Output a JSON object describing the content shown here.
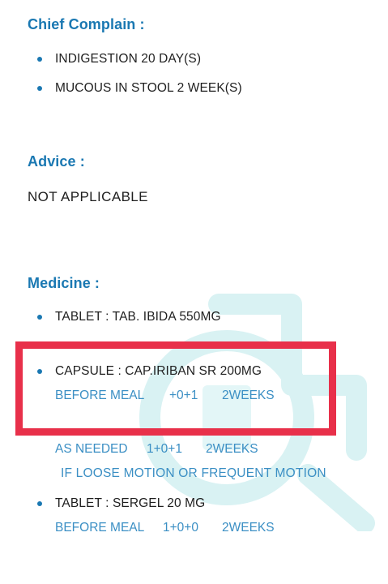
{
  "chief_complain": {
    "heading": "Chief Complain :",
    "items": [
      "INDIGESTION 20 DAY(S)",
      "MUCOUS IN STOOL 2 WEEK(S)"
    ]
  },
  "advice": {
    "heading": "Advice :",
    "text": "NOT APPLICABLE"
  },
  "medicine": {
    "heading": "Medicine :",
    "items": [
      {
        "name": "TABLET : TAB. IBIDA 550MG"
      },
      {
        "name": "CAPSULE : CAP.IRIBAN SR 200MG",
        "timing": "BEFORE MEAL",
        "dose": "+0+1",
        "duration": "2WEEKS",
        "highlighted": true
      },
      {
        "timing": "AS NEEDED",
        "dose": "1+0+1",
        "duration": "2WEEKS",
        "note": "IF LOOSE MOTION OR FREQUENT MOTION"
      },
      {
        "name": "TABLET : SERGEL 20 MG",
        "timing": "BEFORE MEAL",
        "dose": "1+0+0",
        "duration": "2WEEKS"
      }
    ]
  },
  "colors": {
    "heading": "#1a78b2",
    "dose_text": "#3b8fc4",
    "highlight": "#e8304a",
    "watermark": "#d6f1f2"
  },
  "icons": [
    "bullet-dot",
    "watermark-logo"
  ]
}
